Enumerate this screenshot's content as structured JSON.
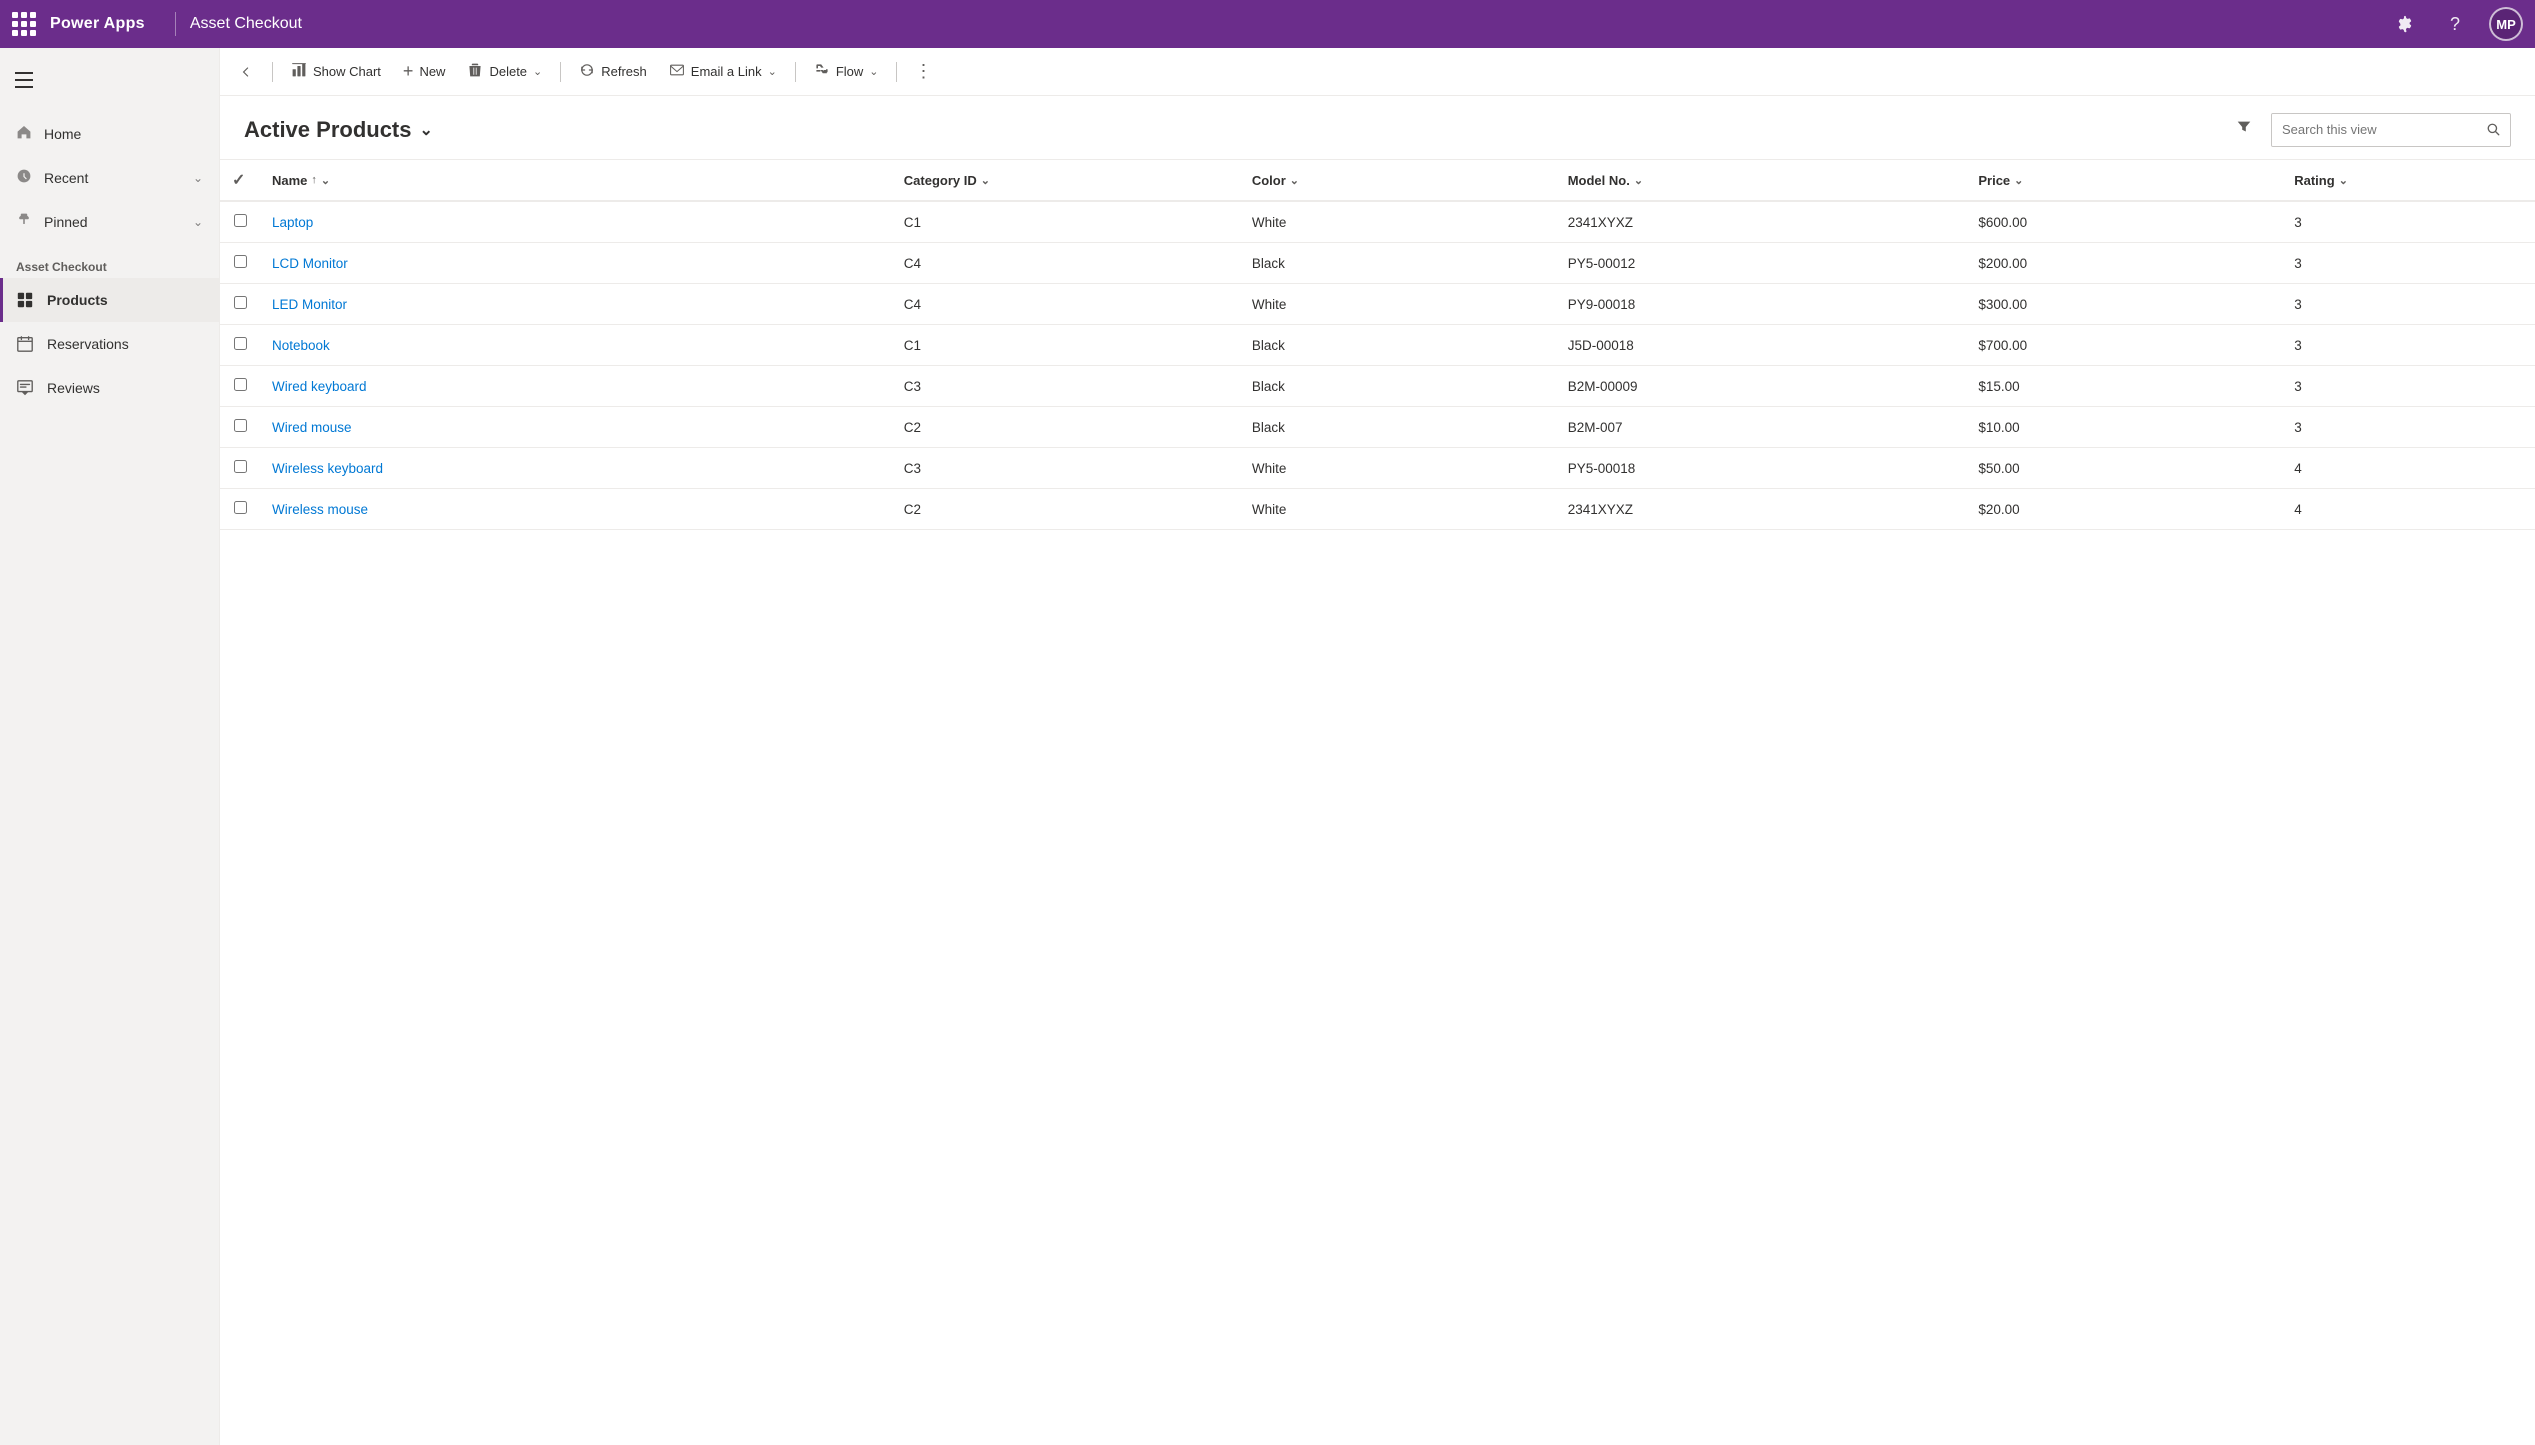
{
  "header": {
    "app_name": "Power Apps",
    "page_title": "Asset Checkout",
    "avatar_initials": "MP",
    "gear_icon": "⚙",
    "help_icon": "?",
    "waffle_label": "waffle"
  },
  "sidebar": {
    "nav_items": [
      {
        "label": "Home",
        "icon": "⌂"
      },
      {
        "label": "Recent",
        "icon": "🕐",
        "has_chevron": true
      },
      {
        "label": "Pinned",
        "icon": "📌",
        "has_chevron": true
      }
    ],
    "section_label": "Asset Checkout",
    "app_items": [
      {
        "label": "Products",
        "icon": "📋",
        "active": true
      },
      {
        "label": "Reservations",
        "icon": "📅",
        "active": false
      },
      {
        "label": "Reviews",
        "icon": "📝",
        "active": false
      }
    ]
  },
  "command_bar": {
    "back_label": "back",
    "show_chart_label": "Show Chart",
    "new_label": "New",
    "delete_label": "Delete",
    "refresh_label": "Refresh",
    "email_link_label": "Email a Link",
    "flow_label": "Flow",
    "more_label": "more options"
  },
  "view": {
    "title": "Active Products",
    "search_placeholder": "Search this view",
    "columns": [
      {
        "key": "name",
        "label": "Name",
        "sortable": true,
        "sort_dir": "asc",
        "has_chevron": true
      },
      {
        "key": "category_id",
        "label": "Category ID",
        "sortable": true
      },
      {
        "key": "color",
        "label": "Color",
        "sortable": true
      },
      {
        "key": "model_no",
        "label": "Model No.",
        "sortable": true
      },
      {
        "key": "price",
        "label": "Price",
        "sortable": true
      },
      {
        "key": "rating",
        "label": "Rating",
        "sortable": true
      }
    ],
    "rows": [
      {
        "name": "Laptop",
        "category_id": "C1",
        "color": "White",
        "model_no": "2341XYXZ",
        "price": "$600.00",
        "rating": "3"
      },
      {
        "name": "LCD Monitor",
        "category_id": "C4",
        "color": "Black",
        "model_no": "PY5-00012",
        "price": "$200.00",
        "rating": "3"
      },
      {
        "name": "LED Monitor",
        "category_id": "C4",
        "color": "White",
        "model_no": "PY9-00018",
        "price": "$300.00",
        "rating": "3"
      },
      {
        "name": "Notebook",
        "category_id": "C1",
        "color": "Black",
        "model_no": "J5D-00018",
        "price": "$700.00",
        "rating": "3"
      },
      {
        "name": "Wired keyboard",
        "category_id": "C3",
        "color": "Black",
        "model_no": "B2M-00009",
        "price": "$15.00",
        "rating": "3"
      },
      {
        "name": "Wired mouse",
        "category_id": "C2",
        "color": "Black",
        "model_no": "B2M-007",
        "price": "$10.00",
        "rating": "3"
      },
      {
        "name": "Wireless keyboard",
        "category_id": "C3",
        "color": "White",
        "model_no": "PY5-00018",
        "price": "$50.00",
        "rating": "4"
      },
      {
        "name": "Wireless mouse",
        "category_id": "C2",
        "color": "White",
        "model_no": "2341XYXZ",
        "price": "$20.00",
        "rating": "4"
      }
    ]
  },
  "colors": {
    "purple": "#6b2d8b",
    "link": "#0078d4",
    "text": "#323130",
    "subtle": "#605e5c"
  }
}
